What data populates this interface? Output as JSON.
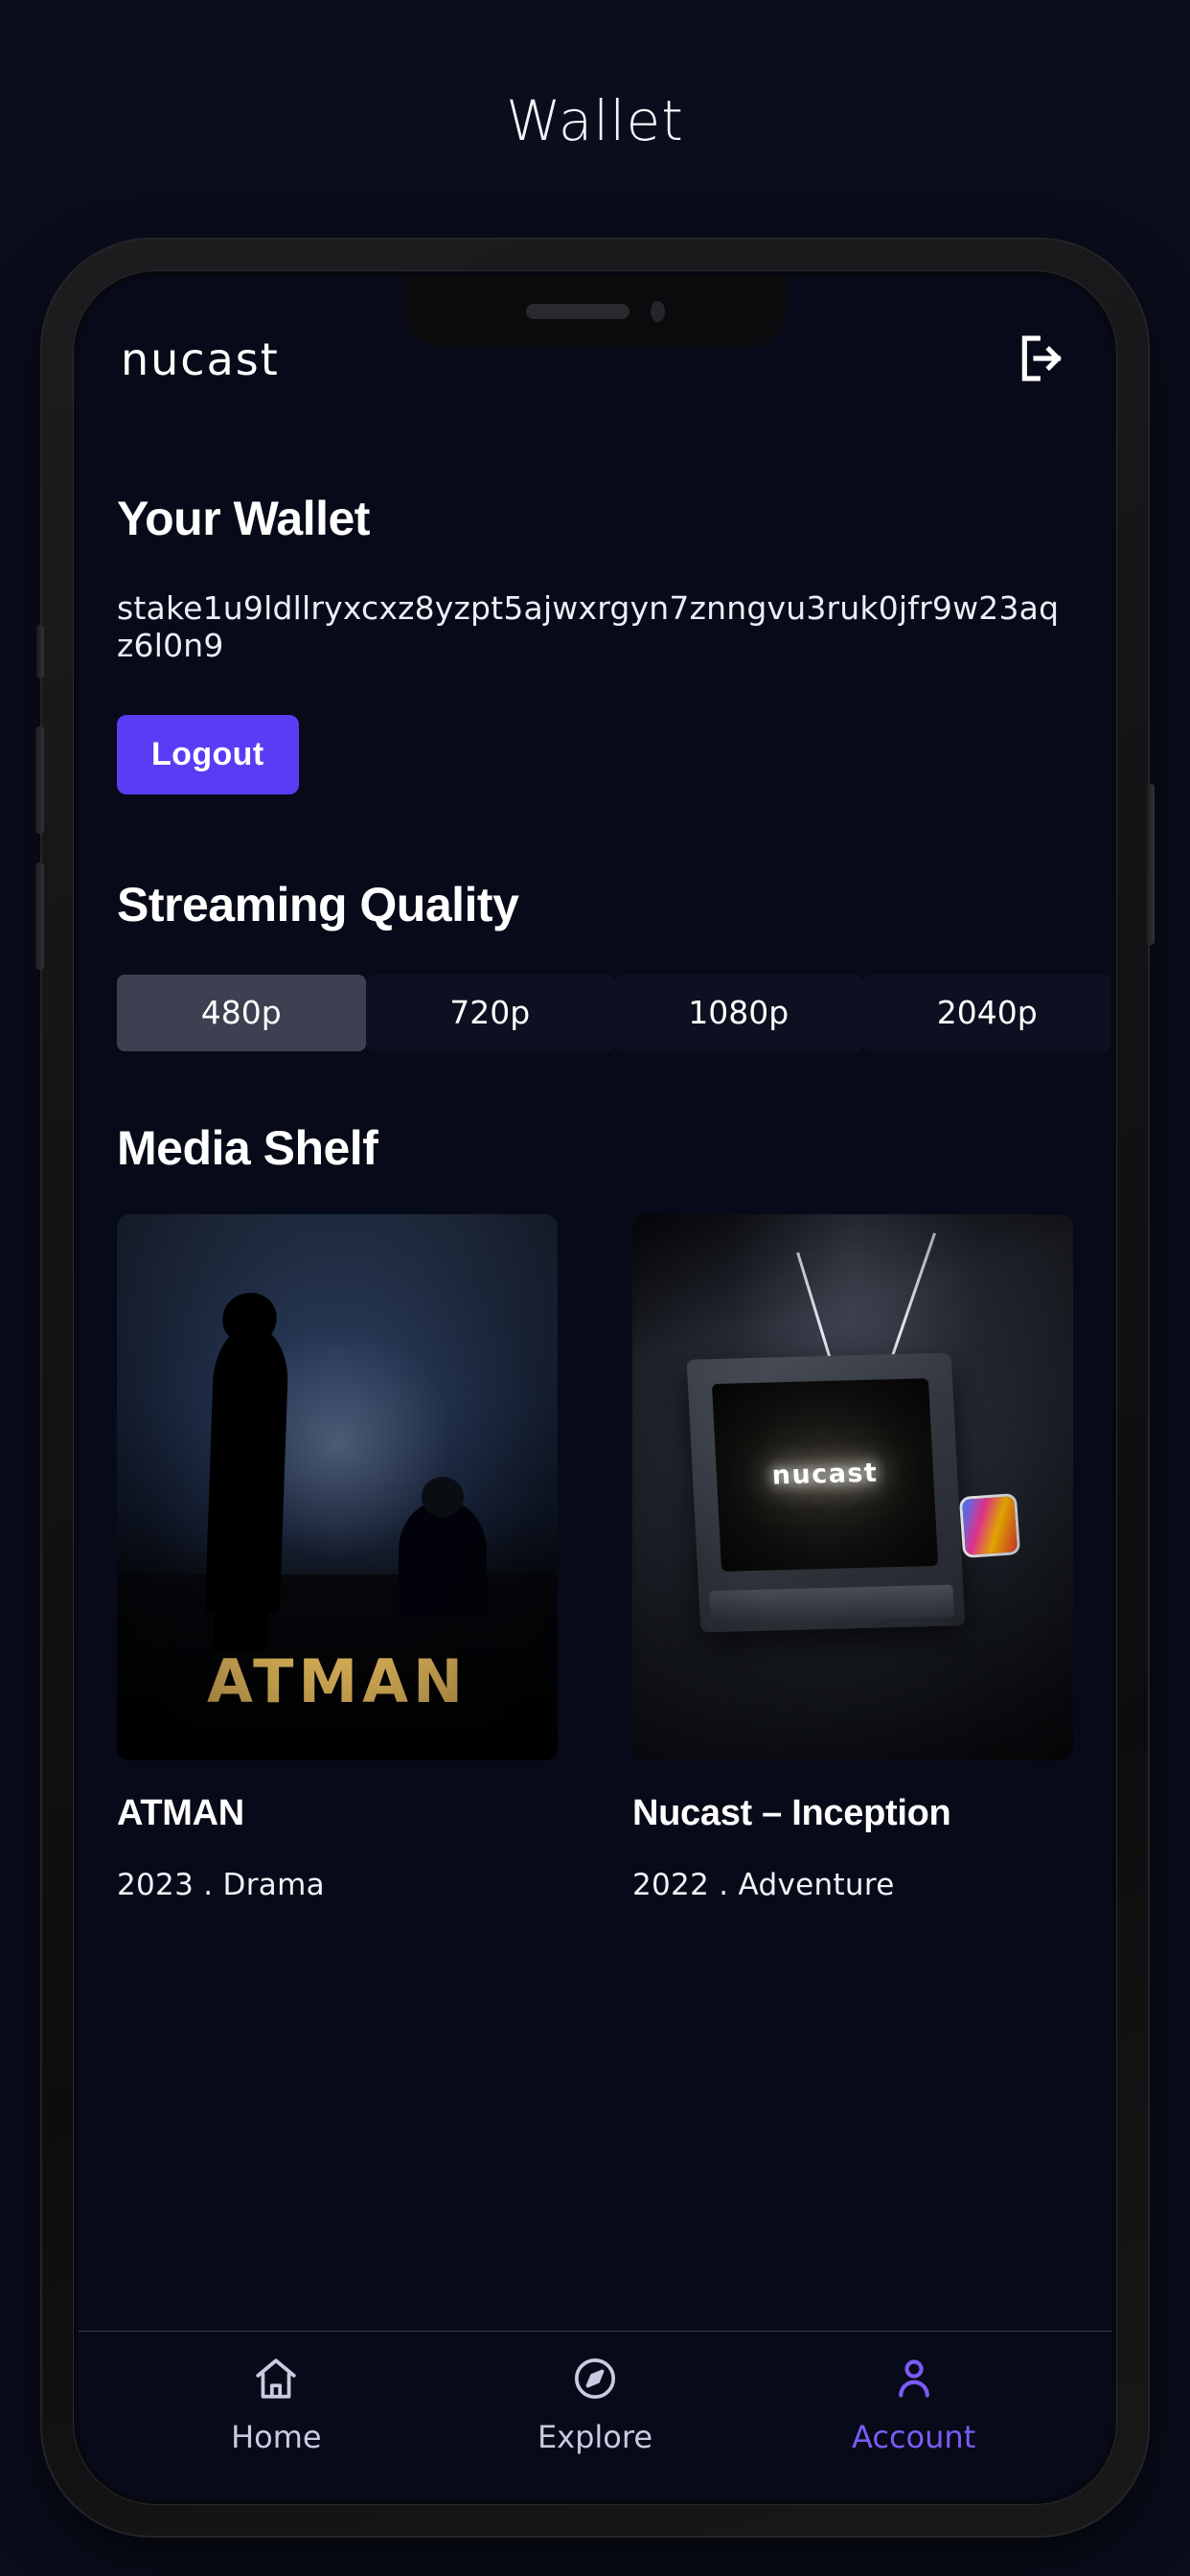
{
  "page": {
    "title": "Wallet"
  },
  "app": {
    "brand": "nucast",
    "logout_icon": "sign-out-icon",
    "wallet": {
      "heading": "Your Wallet",
      "address": "stake1u9ldllryxcxz8yzpt5ajwxrgyn7znngvu3ruk0jfr9w23aqz6l0n9",
      "logout_label": "Logout",
      "logout_color": "#5a3cf4"
    },
    "quality": {
      "heading": "Streaming Quality",
      "selected": "480p",
      "options": [
        {
          "label": "480p",
          "active": true
        },
        {
          "label": "720p",
          "active": false
        },
        {
          "label": "1080p",
          "active": false
        },
        {
          "label": "2040p",
          "active": false
        }
      ]
    },
    "shelf": {
      "heading": "Media Shelf",
      "items": [
        {
          "title": "ATMAN",
          "year": "2023",
          "genre": "Drama",
          "meta": "2023  .  Drama",
          "poster_wordmark": "ATMAN",
          "poster_alt": "two silhouetted figures at dusk"
        },
        {
          "title": "Nucast – Inception",
          "year": "2022",
          "genre": "Adventure",
          "meta": "2022  .  Adventure",
          "poster_screen_text": "nucast",
          "poster_alt": "retro CRT television glowing in a dark room"
        }
      ]
    },
    "bottom_nav": {
      "items": [
        {
          "label": "Home",
          "icon": "home-icon",
          "active": false
        },
        {
          "label": "Explore",
          "icon": "compass-icon",
          "active": false
        },
        {
          "label": "Account",
          "icon": "person-icon",
          "active": true
        }
      ],
      "active_color": "#7b5cf5"
    }
  }
}
